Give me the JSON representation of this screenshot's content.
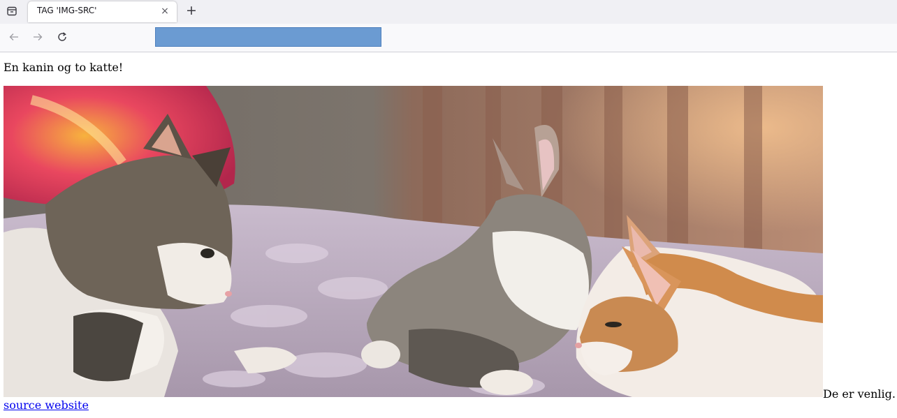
{
  "browser": {
    "tab_title": "TAG 'IMG-SRC'",
    "tab_close_glyph": "×",
    "new_tab_glyph": "+",
    "back_glyph": "←",
    "forward_glyph": "→",
    "url_bar_color": "#6b9bd2"
  },
  "page": {
    "intro_text": "En kanin og to katte!",
    "image_subject": "two cats and a rabbit on a bed",
    "caption_text": "De er venlig.",
    "link_text": "source website",
    "link_color": "#0000ee"
  },
  "icons": [
    "tab-overview-icon",
    "close-icon",
    "plus-icon",
    "back-arrow-icon",
    "forward-arrow-icon",
    "reload-icon"
  ]
}
